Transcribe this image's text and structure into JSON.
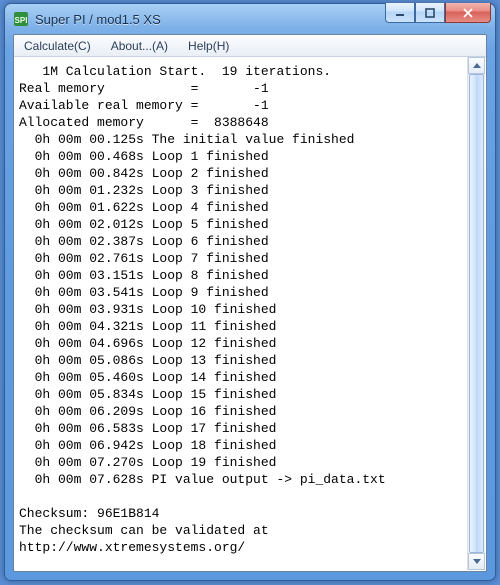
{
  "window": {
    "title": "Super PI / mod1.5 XS"
  },
  "menu": {
    "calculate": "Calculate(C)",
    "about": "About...(A)",
    "help": "Help(H)"
  },
  "output": {
    "header": "   1M Calculation Start.  19 iterations.",
    "real_memory": "Real memory           =       -1",
    "avail_memory": "Available real memory =       -1",
    "allocated_memory": "Allocated memory      =  8388648",
    "initial": "  0h 00m 00.125s The initial value finished",
    "loops": [
      "  0h 00m 00.468s Loop 1 finished",
      "  0h 00m 00.842s Loop 2 finished",
      "  0h 00m 01.232s Loop 3 finished",
      "  0h 00m 01.622s Loop 4 finished",
      "  0h 00m 02.012s Loop 5 finished",
      "  0h 00m 02.387s Loop 6 finished",
      "  0h 00m 02.761s Loop 7 finished",
      "  0h 00m 03.151s Loop 8 finished",
      "  0h 00m 03.541s Loop 9 finished",
      "  0h 00m 03.931s Loop 10 finished",
      "  0h 00m 04.321s Loop 11 finished",
      "  0h 00m 04.696s Loop 12 finished",
      "  0h 00m 05.086s Loop 13 finished",
      "  0h 00m 05.460s Loop 14 finished",
      "  0h 00m 05.834s Loop 15 finished",
      "  0h 00m 06.209s Loop 16 finished",
      "  0h 00m 06.583s Loop 17 finished",
      "  0h 00m 06.942s Loop 18 finished",
      "  0h 00m 07.270s Loop 19 finished"
    ],
    "pi_out": "  0h 00m 07.628s PI value output -> pi_data.txt",
    "blank": "",
    "checksum": "Checksum: 96E1B814",
    "validate1": "The checksum can be validated at",
    "validate2": "http://www.xtremesystems.org/"
  }
}
